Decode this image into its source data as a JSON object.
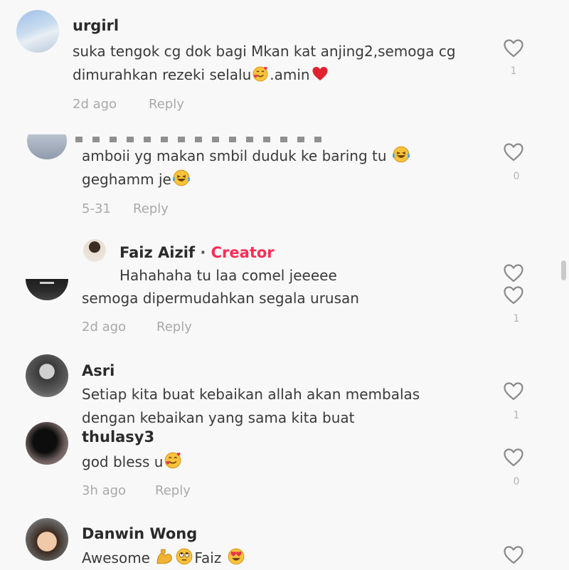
{
  "comments": [
    {
      "username": "urgirl",
      "text_line1": "suka tengok cg dok bagi Mkan kat anjing2,semoga cg",
      "text_line2_a": "dimurahkan rezeki selalu",
      "text_line2_b": ".amin",
      "time": "2d ago",
      "reply_label": "Reply",
      "likes": "1"
    },
    {
      "text_line1": "amboii yg makan smbil duduk ke baring tu",
      "text_line2": "geghamm je",
      "time": "5-31",
      "reply_label": "Reply",
      "likes": "0"
    },
    {
      "text_line1": "semoga dipermudahkan segala urusan",
      "time": "2d ago",
      "reply_label": "Reply",
      "likes": "1",
      "reply": {
        "username": "Faiz Aizif",
        "separator": "·",
        "badge": "Creator",
        "text": "Hahahaha tu laa comel jeeeee"
      }
    },
    {
      "username": "Asri",
      "text_line1": "Setiap kita buat kebaikan allah akan membalas",
      "text_line2": "dengan kebaikan yang sama kita buat",
      "likes": "1"
    },
    {
      "username": "thulasy3",
      "text_line1": "god bless u",
      "time": "3h ago",
      "reply_label": "Reply",
      "likes": "0"
    },
    {
      "username": "Danwin Wong",
      "text_a": "Awesome ",
      "text_b": "Faiz "
    }
  ],
  "colors": {
    "creator_badge": "#fe2c55",
    "heart_outline": "#8a8a8a",
    "meta_text": "#a9a9a9"
  },
  "icons": {
    "like": "heart-outline-icon",
    "emoji_love": "smiling-face-with-hearts-emoji",
    "emoji_heart": "red-heart-emoji",
    "emoji_laugh": "tears-of-joy-emoji",
    "emoji_muscle": "flexed-biceps-emoji",
    "emoji_eyeroll": "eye-roll-emoji",
    "emoji_hearteyes": "heart-eyes-emoji"
  }
}
